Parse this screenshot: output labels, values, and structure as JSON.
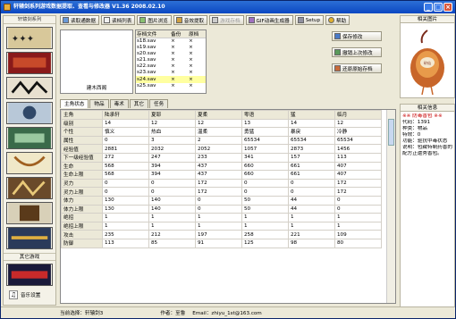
{
  "window": {
    "title": "轩辕剑系列游戏数据提取、查看与修改器  V1.36 2008.02.10",
    "min": "_",
    "max": "□",
    "close": "×"
  },
  "sidebar": {
    "header": "轩辕剑系列",
    "other_games": "其它游戏",
    "music_label": "音乐设置"
  },
  "toolbar": {
    "buttons": [
      {
        "label": "读取通数据"
      },
      {
        "label": "读档列表"
      },
      {
        "label": "图片浏览"
      },
      {
        "label": "音效提取"
      },
      {
        "label": "游戏存档"
      },
      {
        "label": "GIF动画生成器"
      },
      {
        "label": "Setup"
      },
      {
        "label": "帮助"
      }
    ]
  },
  "preview": {
    "label": "建木西阁"
  },
  "saves": {
    "headers": [
      "存档文件",
      "备份",
      "原档"
    ],
    "rows": [
      [
        "s18.sav",
        "×",
        "×"
      ],
      [
        "s19.sav",
        "×",
        "×"
      ],
      [
        "s20.sav",
        "×",
        "×"
      ],
      [
        "s21.sav",
        "×",
        "×"
      ],
      [
        "s22.sav",
        "×",
        "×"
      ],
      [
        "s23.sav",
        "×",
        "×"
      ],
      [
        "s24.sav",
        "×",
        "×"
      ],
      [
        "s25.sav",
        "×",
        "×"
      ]
    ]
  },
  "actions": {
    "save": "保存修改",
    "undo": "撤销上次修改",
    "restore": "还原原始存档"
  },
  "tabs": [
    "主角状态",
    "物品",
    "毒术",
    "其它",
    "任务"
  ],
  "grid": {
    "headers": [
      "主角",
      "陆承轩",
      "夏耶",
      "夏柔",
      "零语",
      "猛",
      "临月"
    ],
    "rows": [
      [
        "级别",
        "14",
        "12",
        "12",
        "13",
        "14",
        "12"
      ],
      [
        "个性",
        "慎义",
        "热血",
        "温柔",
        "勇猛",
        "暴戾",
        "冷静"
      ],
      [
        "属性",
        "0",
        "3",
        "2",
        "65534",
        "65534",
        "65534"
      ],
      [
        "经验值",
        "2881",
        "2032",
        "2052",
        "1057",
        "2873",
        "1456"
      ],
      [
        "下一级经验值",
        "272",
        "247",
        "233",
        "341",
        "157",
        "113"
      ],
      [
        "生命",
        "568",
        "394",
        "437",
        "660",
        "661",
        "407"
      ],
      [
        "生命上限",
        "568",
        "394",
        "437",
        "660",
        "661",
        "407"
      ],
      [
        "灵力",
        "0",
        "0",
        "172",
        "0",
        "0",
        "172"
      ],
      [
        "灵力上限",
        "0",
        "0",
        "172",
        "0",
        "0",
        "172"
      ],
      [
        "体力",
        "130",
        "140",
        "0",
        "50",
        "44",
        "0"
      ],
      [
        "体力上限",
        "130",
        "140",
        "0",
        "50",
        "44",
        "0"
      ],
      [
        "绝招",
        "1",
        "1",
        "1",
        "1",
        "1",
        "1"
      ],
      [
        "绝招上限",
        "1",
        "1",
        "1",
        "1",
        "1",
        "1"
      ],
      [
        "攻击",
        "235",
        "212",
        "197",
        "258",
        "221",
        "109"
      ],
      [
        "防御",
        "113",
        "85",
        "91",
        "125",
        "98",
        "80"
      ]
    ]
  },
  "right": {
    "pic_header": "相关图片",
    "pic_label": "砂仙",
    "info_header": "相关信息",
    "info": [
      "※※ 防毒香包 ※※",
      "代码：1391",
      "种类：物品",
      "特效：0",
      "",
      "功能：驱抗中毒状态",
      "",
      "说明：包藏特制药香的",
      "配方正遭秀香包。"
    ]
  },
  "status": {
    "current_label": "当前选择：轩辕剑3",
    "author": "作者：至鲁",
    "email": "Email：zhiyu_1st@163.com"
  }
}
